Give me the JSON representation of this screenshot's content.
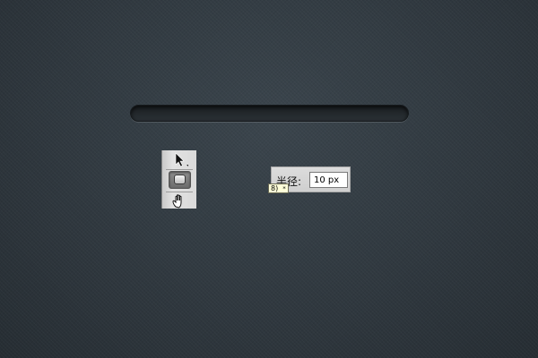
{
  "canvas": {
    "background_color": "#323b42",
    "bar_color": "#1f2428"
  },
  "tools": {
    "items": [
      {
        "name": "path-selection-tool",
        "icon": "arrow-cursor-icon"
      },
      {
        "name": "rounded-rectangle-tool",
        "icon": "rounded-rectangle-icon",
        "active": true
      },
      {
        "name": "hand-tool",
        "icon": "hand-icon"
      }
    ]
  },
  "options": {
    "radius_label": "半径:",
    "radius_value": "10 px"
  },
  "tooltip": {
    "text": "8)",
    "glyph": "*"
  }
}
